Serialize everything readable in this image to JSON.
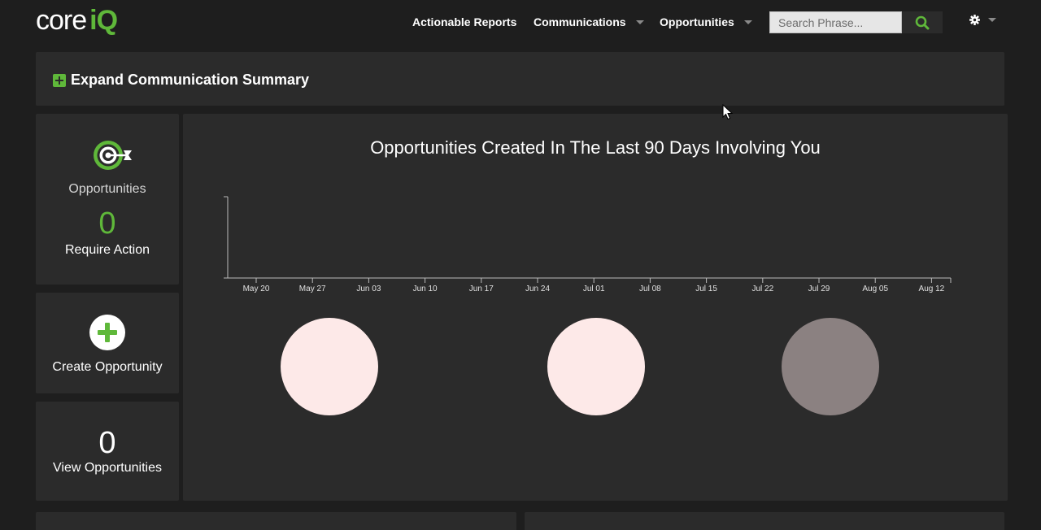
{
  "app": {
    "logo_core": "core",
    "logo_iq": "iQ",
    "brand_color": "#5fb83a"
  },
  "nav": {
    "actionable_reports": "Actionable Reports",
    "communications": "Communications",
    "opportunities": "Opportunities",
    "search_placeholder": "Search Phrase...",
    "search_icon": "search-icon",
    "settings_icon": "gear-icon"
  },
  "summary": {
    "title": "Expand Communication Summary",
    "icon": "plus-square-icon"
  },
  "cards": {
    "opportunities": {
      "icon": "target-icon",
      "label": "Opportunities",
      "count": "0",
      "sub_label": "Require Action"
    },
    "create": {
      "icon": "plus-circle-icon",
      "label": "Create Opportunity"
    },
    "view": {
      "count": "0",
      "label": "View Opportunities"
    }
  },
  "chart_data": {
    "type": "line",
    "title": "Opportunities Created In The Last 90 Days Involving You",
    "x": [
      "May 20",
      "May 27",
      "Jun 03",
      "Jun 10",
      "Jun 17",
      "Jun 24",
      "Jul 01",
      "Jul 08",
      "Jul 15",
      "Jul 22",
      "Jul 29",
      "Aug 05",
      "Aug 12"
    ],
    "series": [],
    "xlabel": "",
    "ylabel": "",
    "grid": false,
    "legend": "none",
    "indicators": [
      {
        "color": "#fde9e8"
      },
      {
        "color": "#fde9e8"
      },
      {
        "color": "#8b8181"
      }
    ]
  }
}
